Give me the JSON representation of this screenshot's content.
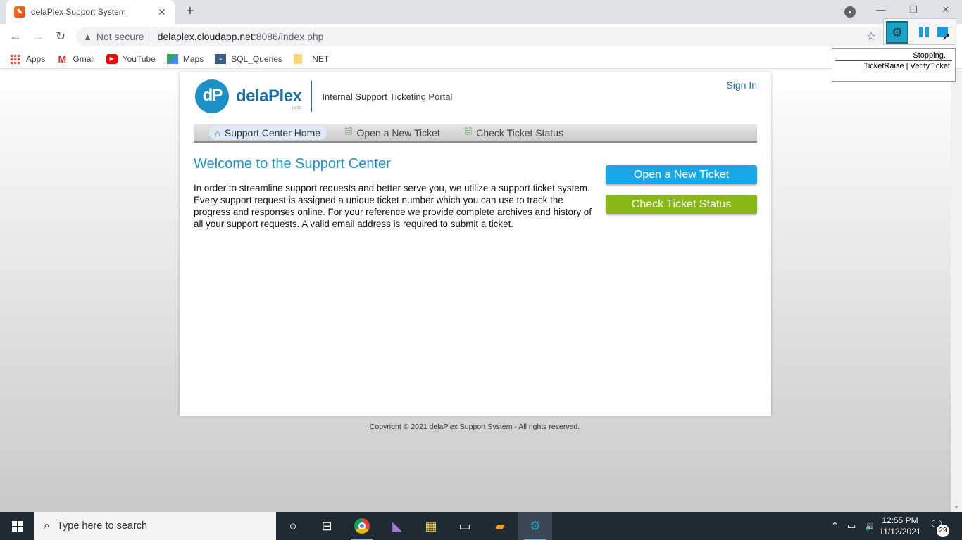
{
  "browser": {
    "tab_title": "delaPlex Support System",
    "tab_close": "✕",
    "new_tab": "+",
    "security_label": "Not secure",
    "url_host": "delaplex.cloudapp.net",
    "url_rest": ":8086/index.php",
    "bookmarks": [
      {
        "label": "Apps",
        "icon": "apps-grid-icon"
      },
      {
        "label": "Gmail",
        "icon": "gmail-icon"
      },
      {
        "label": "YouTube",
        "icon": "youtube-icon"
      },
      {
        "label": "Maps",
        "icon": "maps-icon"
      },
      {
        "label": "SQL_Queries",
        "icon": "sql-queries-icon"
      },
      {
        "label": ".NET",
        "icon": "folder-icon"
      }
    ]
  },
  "automation": {
    "status": "Stopping...",
    "process": "TicketRaise | VerifyTicket"
  },
  "page": {
    "brand": "delaPlex",
    "brand_sub": "pvt.ltd.",
    "logo_initials": "dP",
    "tagline": "Internal Support Ticketing Portal",
    "sign_in": "Sign In",
    "nav": [
      {
        "label": "Support Center Home",
        "icon": "home-icon",
        "active": true
      },
      {
        "label": "Open a New Ticket",
        "icon": "new-ticket-icon",
        "active": false
      },
      {
        "label": "Check Ticket Status",
        "icon": "ticket-status-icon",
        "active": false
      }
    ],
    "heading": "Welcome to the Support Center",
    "intro": "In order to streamline support requests and better serve you, we utilize a support ticket system. Every support request is assigned a unique ticket number which you can use to track the progress and responses online. For your reference we provide complete archives and history of all your support requests. A valid email address is required to submit a ticket.",
    "btn_open": "Open a New Ticket",
    "btn_check": "Check Ticket Status",
    "copyright": "Copyright © 2021 delaPlex Support System - All rights reserved."
  },
  "taskbar": {
    "search_placeholder": "Type here to search",
    "time": "12:55 PM",
    "date": "11/12/2021",
    "notification_count": "29"
  },
  "colors": {
    "brand_blue": "#1d90c8",
    "btn_blue": "#19a8e5",
    "btn_green": "#8ab915",
    "taskbar": "#1f2a33"
  }
}
